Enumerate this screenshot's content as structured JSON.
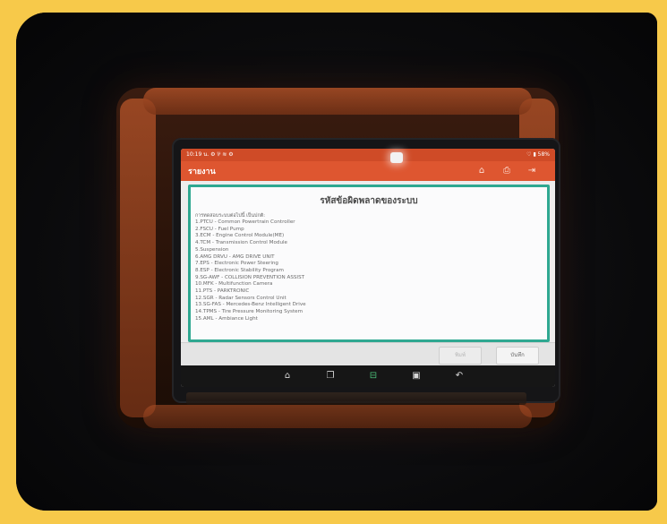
{
  "device": {
    "status_time": "10:19 น.",
    "status_left_icons": "⚙ ⅌ ≋ ⚙",
    "status_right": "♡ ▮ 58%"
  },
  "app": {
    "title": "รายงาน",
    "icons": [
      "home-icon",
      "print-icon",
      "exit-icon"
    ],
    "accent": "#de5630",
    "teal": "#2fa891"
  },
  "report": {
    "heading": "รหัสข้อผิดพลาดของระบบ",
    "intro": "การทดสอบระบบต่อไปนี้ เป็นปกติ:",
    "items": [
      "1.PTCU - Common Powertrain Controller",
      "2.FSCU - Fuel Pump",
      "3.ECM - Engine Control Module(ME)",
      "4.TCM - Transmission Control Module",
      "5.Suspension",
      "6.AMG DRVU - AMG DRIVE UNIT",
      "7.EPS - Electronic Power Steering",
      "8.ESP - Electronic Stability Program",
      "9.SG-AWF - COLLISION PREVENTION ASSIST",
      "10.MFK - Multifunction Camera",
      "11.PTS - PARKTRONIC",
      "12.SGR - Radar Sensors Control Unit",
      "13.SG-FAS - Mercedes-Benz Intelligent Drive",
      "14.TPMS - Tire Pressure Monitoring System",
      "15.AML - Ambiance Light"
    ]
  },
  "buttons": {
    "print": "พิมพ์",
    "save": "บันทึก"
  },
  "nav": [
    "home-icon",
    "recent-apps-icon",
    "vci-icon",
    "screenshot-icon",
    "back-icon"
  ]
}
